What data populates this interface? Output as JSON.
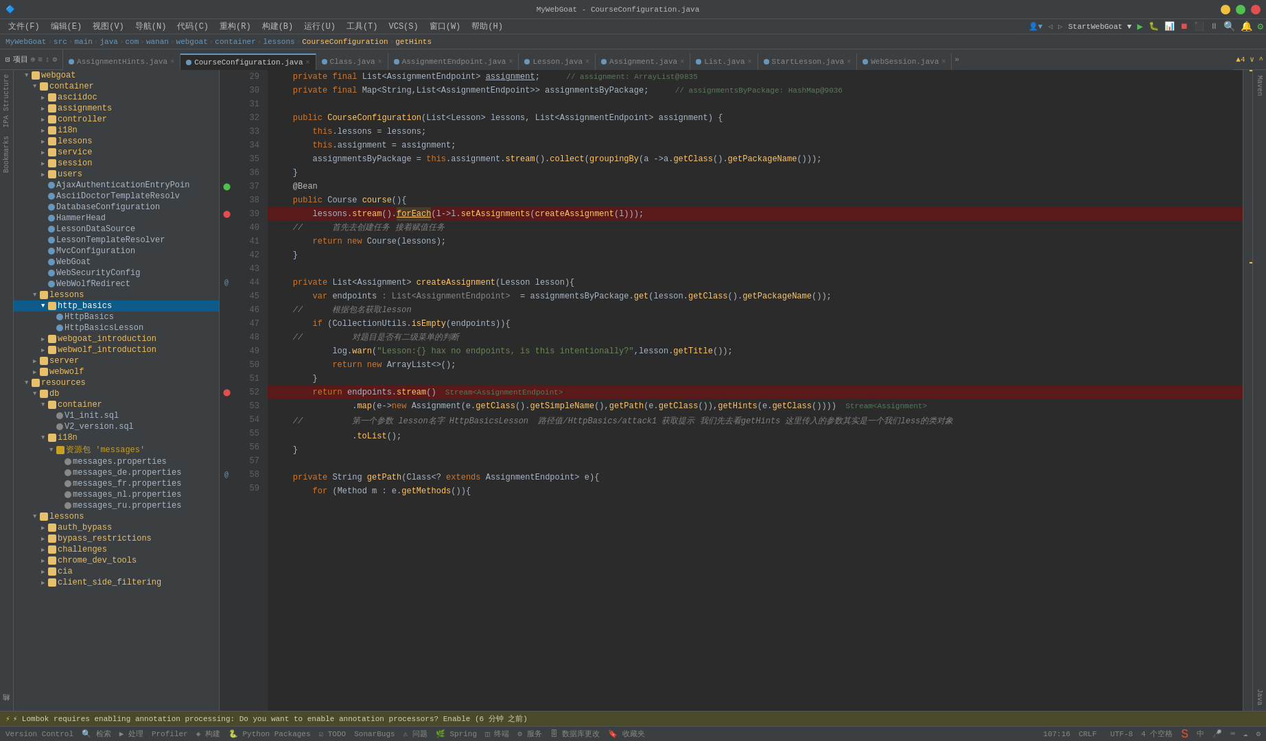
{
  "app": {
    "title": "MyWebGoat - CourseConfiguration.java",
    "window_controls": [
      "minimize",
      "maximize",
      "close"
    ]
  },
  "menu": {
    "items": [
      "文件(F)",
      "编辑(E)",
      "视图(V)",
      "导航(N)",
      "代码(C)",
      "重构(R)",
      "构建(B)",
      "运行(U)",
      "工具(T)",
      "VCS(S)",
      "窗口(W)",
      "帮助(H)"
    ]
  },
  "breadcrumb": {
    "items": [
      "MyWebGoat",
      "src",
      "main",
      "java",
      "com",
      "wanan",
      "webgoat",
      "container",
      "lessons",
      "CourseConfiguration",
      "getHints"
    ]
  },
  "toolbar": {
    "project_label": "项目",
    "buttons": [
      "⊕",
      "≡",
      "↑↓",
      "⚙"
    ]
  },
  "tabs": [
    {
      "label": "AssignmentHints.java",
      "color": "#6897bb",
      "active": false
    },
    {
      "label": "CourseConfiguration.java",
      "color": "#6897bb",
      "active": true
    },
    {
      "label": "Class.java",
      "color": "#6897bb",
      "active": false
    },
    {
      "label": "AssignmentEndpoint.java",
      "color": "#6897bb",
      "active": false
    },
    {
      "label": "Lesson.java",
      "color": "#6897bb",
      "active": false
    },
    {
      "label": "Assignment.java",
      "color": "#6897bb",
      "active": false
    },
    {
      "label": "List.java",
      "color": "#6897bb",
      "active": false
    },
    {
      "label": "StartLesson.java",
      "color": "#6897bb",
      "active": false
    },
    {
      "label": "WebSession.java",
      "color": "#6897bb",
      "active": false
    }
  ],
  "sidebar": {
    "project_root": "MyWebGoat",
    "tree": [
      {
        "level": 0,
        "type": "folder",
        "label": "webgoat",
        "expanded": true
      },
      {
        "level": 1,
        "type": "folder",
        "label": "container",
        "expanded": true
      },
      {
        "level": 2,
        "type": "folder",
        "label": "asciidoc",
        "expanded": false
      },
      {
        "level": 2,
        "type": "folder",
        "label": "assignments",
        "expanded": false
      },
      {
        "level": 2,
        "type": "folder",
        "label": "controller",
        "expanded": false
      },
      {
        "level": 2,
        "type": "folder",
        "label": "i18n",
        "expanded": false
      },
      {
        "level": 2,
        "type": "folder",
        "label": "lessons",
        "expanded": false
      },
      {
        "level": 2,
        "type": "folder",
        "label": "service",
        "expanded": false
      },
      {
        "level": 2,
        "type": "folder",
        "label": "session",
        "expanded": false
      },
      {
        "level": 2,
        "type": "folder",
        "label": "users",
        "expanded": false
      },
      {
        "level": 2,
        "type": "class",
        "label": "AjaxAuthenticationEntryPoin",
        "expanded": false
      },
      {
        "level": 2,
        "type": "class",
        "label": "AsciiDoctorTemplateResolv",
        "expanded": false
      },
      {
        "level": 2,
        "type": "class",
        "label": "DatabaseConfiguration",
        "expanded": false
      },
      {
        "level": 2,
        "type": "class",
        "label": "HammerHead",
        "expanded": false
      },
      {
        "level": 2,
        "type": "class",
        "label": "LessonDataSource",
        "expanded": false
      },
      {
        "level": 2,
        "type": "class",
        "label": "LessonTemplateResolver",
        "expanded": false
      },
      {
        "level": 2,
        "type": "class",
        "label": "MvcConfiguration",
        "expanded": false
      },
      {
        "level": 2,
        "type": "class",
        "label": "WebGoat",
        "expanded": false
      },
      {
        "level": 2,
        "type": "class",
        "label": "WebSecurityConfig",
        "expanded": false
      },
      {
        "level": 2,
        "type": "class",
        "label": "WebWolfRedirect",
        "expanded": false
      },
      {
        "level": 1,
        "type": "folder",
        "label": "lessons",
        "expanded": true
      },
      {
        "level": 2,
        "type": "folder",
        "label": "http_basics",
        "expanded": true,
        "selected": true
      },
      {
        "level": 3,
        "type": "class",
        "label": "HttpBasics",
        "expanded": false
      },
      {
        "level": 3,
        "type": "class",
        "label": "HttpBasicsLesson",
        "expanded": false
      },
      {
        "level": 2,
        "type": "folder",
        "label": "webgoat_introduction",
        "expanded": false
      },
      {
        "level": 2,
        "type": "folder",
        "label": "webwolf_introduction",
        "expanded": false
      },
      {
        "level": 1,
        "type": "folder",
        "label": "server",
        "expanded": false
      },
      {
        "level": 1,
        "type": "folder",
        "label": "webwolf",
        "expanded": false
      },
      {
        "level": 0,
        "type": "folder",
        "label": "resources",
        "expanded": true
      },
      {
        "level": 1,
        "type": "folder",
        "label": "db",
        "expanded": true
      },
      {
        "level": 2,
        "type": "folder",
        "label": "container",
        "expanded": true
      },
      {
        "level": 3,
        "type": "file",
        "label": "V1_init.sql",
        "expanded": false
      },
      {
        "level": 3,
        "type": "file",
        "label": "V2_version.sql",
        "expanded": false
      },
      {
        "level": 2,
        "type": "folder",
        "label": "i18n",
        "expanded": true
      },
      {
        "level": 3,
        "type": "folder",
        "label": "资源包 'messages'",
        "expanded": true
      },
      {
        "level": 4,
        "type": "file",
        "label": "messages.properties",
        "expanded": false
      },
      {
        "level": 4,
        "type": "file",
        "label": "messages_de.properties",
        "expanded": false
      },
      {
        "level": 4,
        "type": "file",
        "label": "messages_fr.properties",
        "expanded": false
      },
      {
        "level": 4,
        "type": "file",
        "label": "messages_nl.properties",
        "expanded": false
      },
      {
        "level": 4,
        "type": "file",
        "label": "messages_ru.properties",
        "expanded": false
      },
      {
        "level": 1,
        "type": "folder",
        "label": "lessons",
        "expanded": true
      },
      {
        "level": 2,
        "type": "folder",
        "label": "auth_bypass",
        "expanded": false
      },
      {
        "level": 2,
        "type": "folder",
        "label": "bypass_restrictions",
        "expanded": false
      },
      {
        "level": 2,
        "type": "folder",
        "label": "challenges",
        "expanded": false
      },
      {
        "level": 2,
        "type": "folder",
        "label": "chrome_dev_tools",
        "expanded": false
      },
      {
        "level": 2,
        "type": "folder",
        "label": "cia",
        "expanded": false
      },
      {
        "level": 2,
        "type": "folder",
        "label": "client_side_filtering",
        "expanded": false
      }
    ]
  },
  "code": {
    "filename": "CourseConfiguration.java",
    "lines": [
      {
        "num": 29,
        "content": "    private final List<AssignmentEndpoint> assignment;    // assignment: ArrayList@9835",
        "type": "normal"
      },
      {
        "num": 30,
        "content": "    private final Map<String,List<AssignmentEndpoint>> assignmentsByPackage;    // assignmentsByPackage: HashMap@9036",
        "type": "normal"
      },
      {
        "num": 31,
        "content": "",
        "type": "normal"
      },
      {
        "num": 32,
        "content": "    public CourseConfiguration(List<Lesson> lessons, List<AssignmentEndpoint> assignment) {",
        "type": "normal"
      },
      {
        "num": 33,
        "content": "        this.lessons = lessons;",
        "type": "normal"
      },
      {
        "num": 34,
        "content": "        this.assignment = assignment;",
        "type": "normal"
      },
      {
        "num": 35,
        "content": "        assignmentsByPackage = this.assignment.stream().collect(groupingBy(a ->a.getClass().getPackageName()));",
        "type": "normal"
      },
      {
        "num": 36,
        "content": "    }",
        "type": "normal"
      },
      {
        "num": 37,
        "content": "    @Bean",
        "type": "bean"
      },
      {
        "num": 38,
        "content": "    public Course course(){",
        "type": "normal"
      },
      {
        "num": 39,
        "content": "        lessons.stream().forEach(l->l.setAssignments(createAssignment(l)));",
        "type": "breakpoint"
      },
      {
        "num": 40,
        "content": "    //      首先去创建任务 接着赋值任务",
        "type": "normal"
      },
      {
        "num": 41,
        "content": "        return new Course(lessons);",
        "type": "normal"
      },
      {
        "num": 42,
        "content": "    }",
        "type": "normal"
      },
      {
        "num": 43,
        "content": "",
        "type": "normal"
      },
      {
        "num": 44,
        "content": "    private List<Assignment> createAssignment(Lesson lesson){",
        "type": "annotation"
      },
      {
        "num": 45,
        "content": "        var endpoints : List<AssignmentEndpoint>  = assignmentsByPackage.get(lesson.getClass().getPackageName());",
        "type": "normal"
      },
      {
        "num": 46,
        "content": "    //      根据包名获取lesson",
        "type": "normal"
      },
      {
        "num": 47,
        "content": "        if (CollectionUtils.isEmpty(endpoints)){",
        "type": "normal"
      },
      {
        "num": 48,
        "content": "    //          对题目是否有二级菜单的判断",
        "type": "normal"
      },
      {
        "num": 49,
        "content": "            log.warn(\"Lesson:{} hax no endpoints, is this intentionally?\",lesson.getTitle());",
        "type": "normal"
      },
      {
        "num": 50,
        "content": "            return new ArrayList<>();",
        "type": "normal"
      },
      {
        "num": 51,
        "content": "        }",
        "type": "normal"
      },
      {
        "num": 52,
        "content": "        return endpoints.stream()  Stream<AssignmentEndpoint>",
        "type": "breakpoint2"
      },
      {
        "num": 53,
        "content": "                .map(e->new Assignment(e.getClass().getSimpleName(),getPath(e.getClass()),getHints(e.getClass())))  Stream<Assignment>",
        "type": "normal"
      },
      {
        "num": 54,
        "content": "    //          第一个参数 lesson名字 HttpBasicsLesson  路径值/HttpBasics/attack1 获取提示 我们先去看getHints 这里传入的参数其实是一个我们less的类对象",
        "type": "normal"
      },
      {
        "num": 55,
        "content": "                .toList();",
        "type": "normal"
      },
      {
        "num": 56,
        "content": "    }",
        "type": "normal"
      },
      {
        "num": 57,
        "content": "",
        "type": "normal"
      },
      {
        "num": 58,
        "content": "    private String getPath(Class<? extends AssignmentEndpoint> e){",
        "type": "annotation2"
      },
      {
        "num": 59,
        "content": "        for (Method m : e.getMethods()){",
        "type": "normal"
      }
    ]
  },
  "statusbar": {
    "version_control": "Version Control",
    "search": "🔍 检索",
    "run": "▶ 处理",
    "profiler": "📊 Profiler",
    "structure": "◈ 构建",
    "python": "🐍 Python Packages",
    "todo": "☑ TODO",
    "bugsnag": "🔍 SonarBugs",
    "issues": "⚠ 问题",
    "spring": "🌿 Spring",
    "end": "◫ 终端",
    "services": "⚙ 服务",
    "database": "🗄 数据库更改",
    "bookmarks": "🔖 收藏夹",
    "position": "107:16",
    "encoding": "CRLF  UTF-8",
    "spaces": "4 个空格",
    "warning_count": "▲4 ∨ ^"
  },
  "run_toolbar": {
    "config": "StartWebGoat ▼",
    "buttons": [
      "▶",
      "⟳",
      "⏸",
      "⏹",
      "⬛",
      "📷",
      "⚙",
      "🔍"
    ]
  },
  "notification": {
    "text": "⚡ Lombok requires enabling annotation processing: Do you want to enable annotation processors? Enable (6 分钟 之前)"
  }
}
